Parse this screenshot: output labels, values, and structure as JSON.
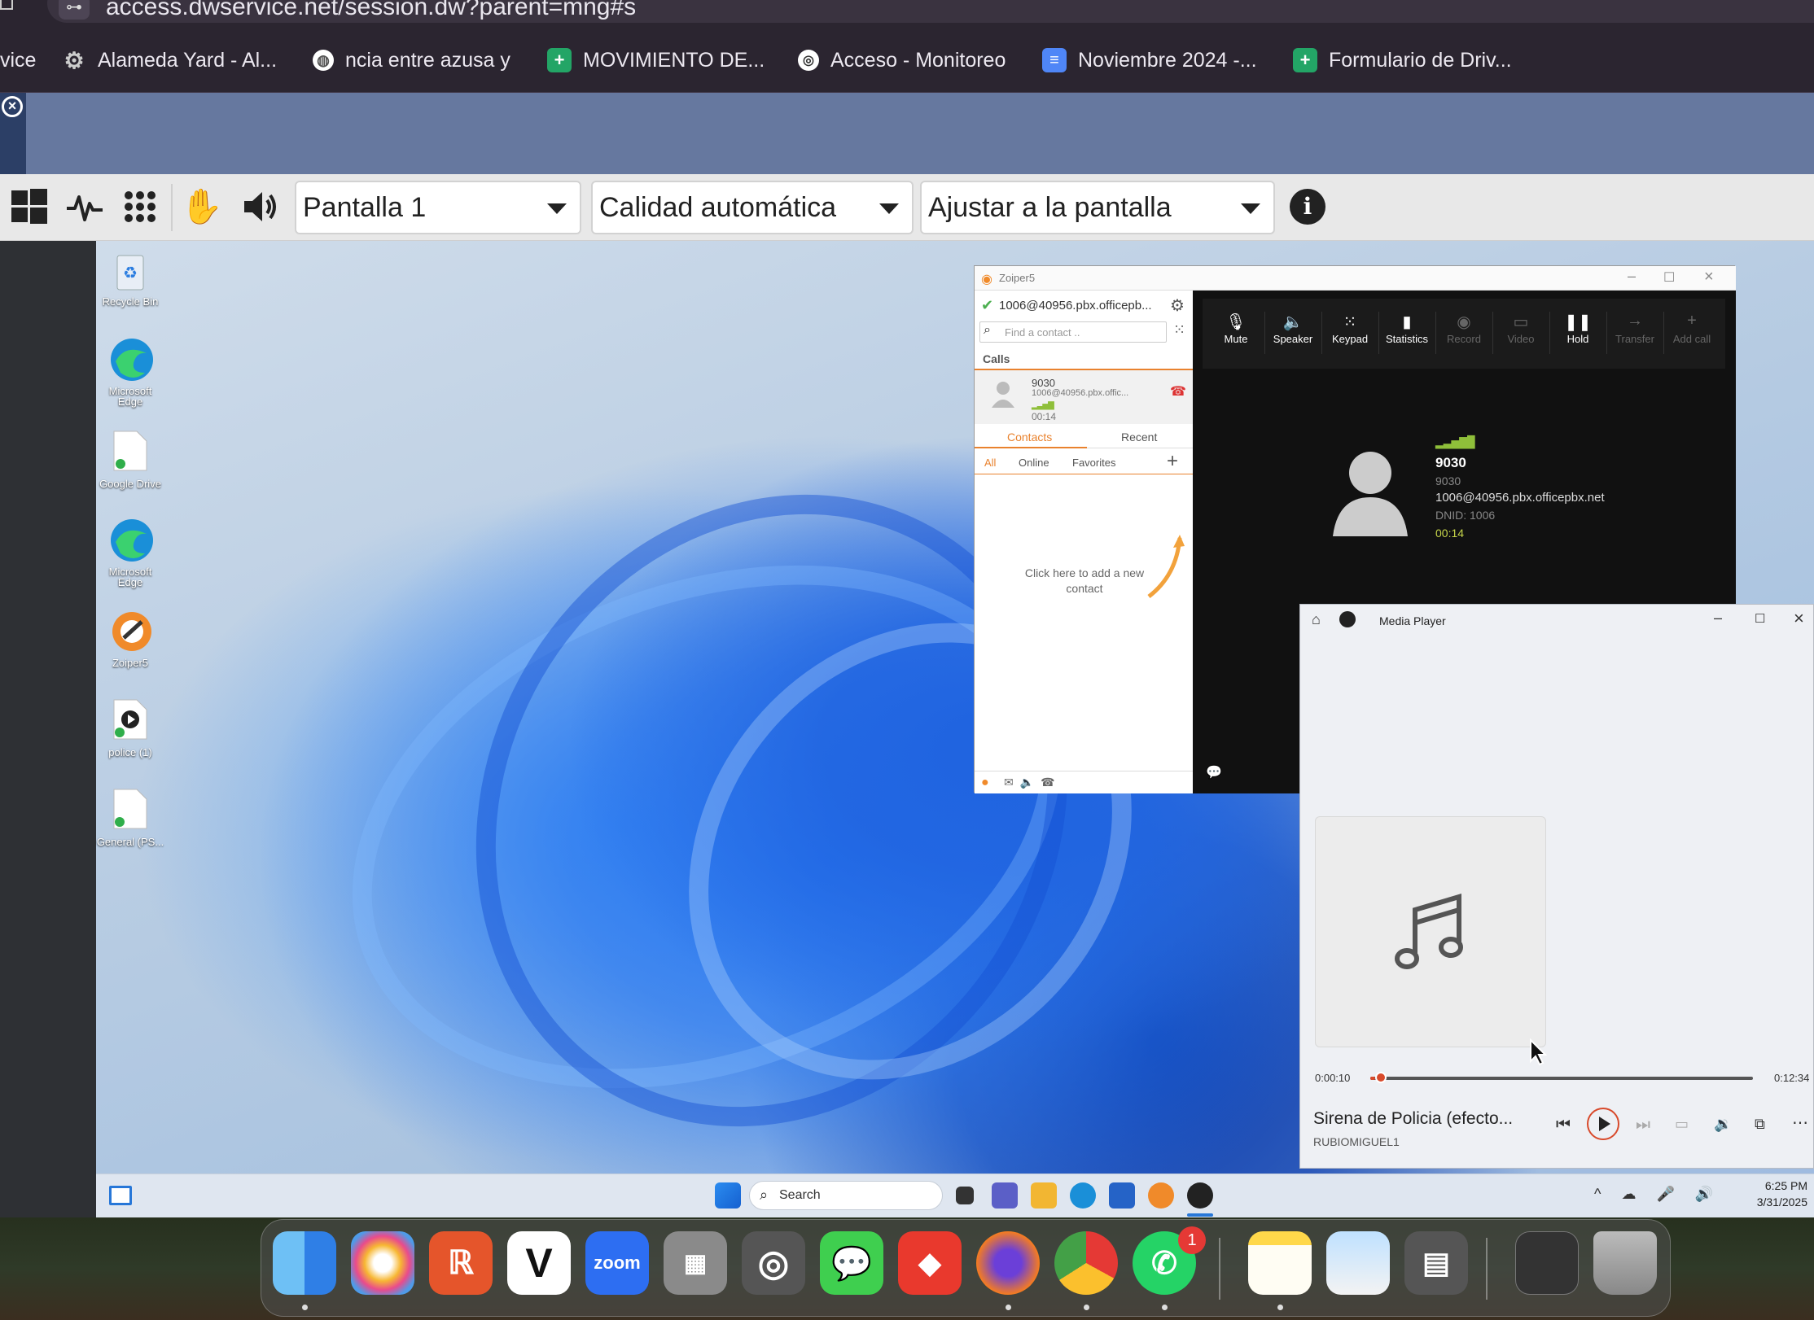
{
  "browser": {
    "url": "access.dwservice.net/session.dw?parent=mng#s",
    "bookmarks": [
      {
        "label": "vice",
        "icon": "partial-icon"
      },
      {
        "label": "Alameda Yard - Al...",
        "icon": "gear-site-icon"
      },
      {
        "label": "ncia entre azusa y",
        "icon": "globe-icon"
      },
      {
        "label": "MOVIMIENTO DE...",
        "icon": "sheets-icon"
      },
      {
        "label": "Acceso - Monitoreo",
        "icon": "monitor-site-icon"
      },
      {
        "label": "Noviembre 2024 -...",
        "icon": "docs-icon"
      },
      {
        "label": "Formulario de Driv...",
        "icon": "sheets-icon"
      }
    ]
  },
  "toolbar": {
    "screen_select": "Pantalla 1",
    "quality_select": "Calidad automática",
    "fit_select": "Ajustar a la pantalla"
  },
  "desktop": {
    "icons": [
      {
        "label": "Recycle Bin",
        "icon": "recycle-bin-icon"
      },
      {
        "label": "Microsoft Edge",
        "icon": "edge-icon"
      },
      {
        "label": "Google Drive",
        "icon": "file-icon"
      },
      {
        "label": "Microsoft Edge",
        "icon": "edge-icon"
      },
      {
        "label": "Zoiper5",
        "icon": "zoiper-icon"
      },
      {
        "label": "police (1)",
        "icon": "media-file-icon"
      },
      {
        "label": "General (PS...",
        "icon": "file-icon"
      }
    ]
  },
  "zoiper": {
    "title": "Zoiper5",
    "account": "1006@40956.pbx.officepb...",
    "search_placeholder": "Find a contact ..",
    "calls_header": "Calls",
    "call_item": {
      "number": "9030",
      "account": "1006@40956.pbx.offic...",
      "duration": "00:14"
    },
    "tabs": [
      "Contacts",
      "Recent"
    ],
    "filters": [
      "All",
      "Online",
      "Favorites"
    ],
    "empty_hint": "Click here to add a new contact",
    "controls": [
      {
        "label": "Mute",
        "icon": "mute-icon"
      },
      {
        "label": "Speaker",
        "icon": "speaker-icon"
      },
      {
        "label": "Keypad",
        "icon": "keypad-icon"
      },
      {
        "label": "Statistics",
        "icon": "statistics-icon"
      },
      {
        "label": "Record",
        "icon": "record-icon"
      },
      {
        "label": "Video",
        "icon": "video-icon"
      },
      {
        "label": "Hold",
        "icon": "pause-icon"
      },
      {
        "label": "Transfer",
        "icon": "transfer-icon"
      },
      {
        "label": "Add call",
        "icon": "plus-icon"
      }
    ],
    "active_call": {
      "name": "9030",
      "number": "9030",
      "account": "1006@40956.pbx.officepbx.net",
      "dnid": "DNID: 1006",
      "duration": "00:14"
    }
  },
  "media_player": {
    "title": "Media Player",
    "elapsed": "0:00:10",
    "total": "0:12:34",
    "progress": 0.013,
    "track_title": "Sirena de Policia (efecto...",
    "artist": "RUBIOMIGUEL1"
  },
  "taskbar": {
    "search_placeholder": "Search",
    "time": "6:25 PM",
    "date": "3/31/2025"
  },
  "dock": {
    "apps": [
      "Finder",
      "Photos",
      "Reeder",
      "Vectornator",
      "zoom",
      "Launchpad",
      "Screen Recorder",
      "Messages",
      "AnyDesk",
      "Firefox",
      "Chrome",
      "WhatsApp",
      "Notes",
      "Preview",
      "Calculator",
      "Screenshot",
      "Trash"
    ],
    "whatsapp_badge": "1",
    "zoom_label": "zoom"
  },
  "colors": {
    "zoiper_accent": "#e9822e",
    "call_green": "#8fbf3a",
    "media_accent": "#d84a2b"
  }
}
